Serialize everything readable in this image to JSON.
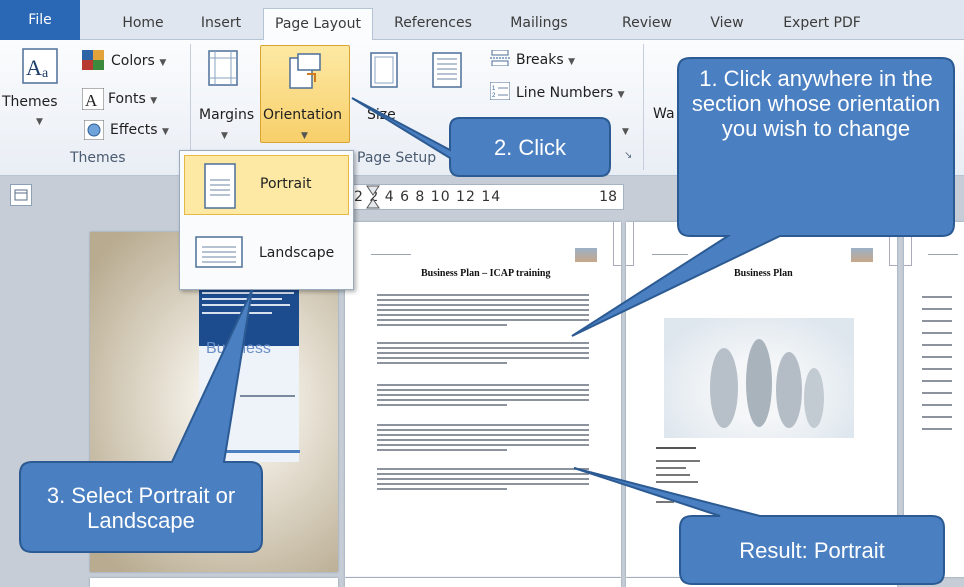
{
  "tabs": [
    {
      "label": "File"
    },
    {
      "label": "Home"
    },
    {
      "label": "Insert"
    },
    {
      "label": "Page Layout"
    },
    {
      "label": "References"
    },
    {
      "label": "Mailings"
    },
    {
      "label": "Review"
    },
    {
      "label": "View"
    },
    {
      "label": "Expert PDF"
    }
  ],
  "ribbon": {
    "themes_label": "Themes",
    "colors_label": "Colors",
    "fonts_label": "Fonts",
    "effects_label": "Effects",
    "themes_group": "Themes",
    "margins_label": "Margins",
    "orientation_label": "Orientation",
    "size_label": "Size",
    "breaks_label": "Breaks",
    "line_numbers_label": "Line Numbers",
    "page_setup_group": "Page Setup",
    "wa_label": "Wa"
  },
  "ruler": {
    "ticks": "2  2  4  6  8  10 12 14",
    "end": "18"
  },
  "dropdown": {
    "portrait": "Portrait",
    "landscape": "Landscape"
  },
  "document": {
    "page1_word": "Business",
    "page2_title": "Business Plan – ICAP training",
    "page3_title": "Business Plan"
  },
  "callouts": {
    "c1": "1. Click anywhere in the section whose orientation you wish to change",
    "c2": "2. Click",
    "c3": "3. Select Portrait or Landscape",
    "c4": "Result: Portrait"
  },
  "colors": {
    "callout_fill": "#4a7fc1",
    "callout_border": "#2c5a93",
    "file_tab": "#2a67b5",
    "selected_item": "#fde9a4"
  }
}
